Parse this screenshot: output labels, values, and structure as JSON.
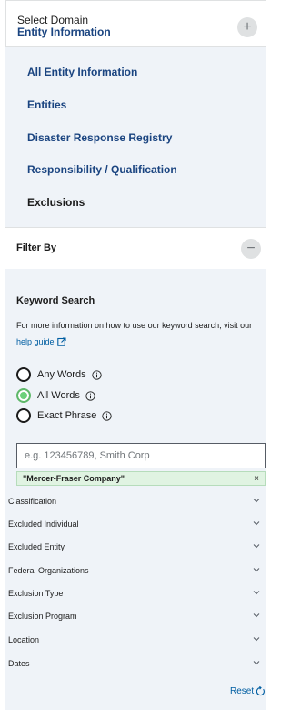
{
  "domain": {
    "select_label": "Select Domain",
    "current": "Entity Information",
    "expand_symbol": "+",
    "items": [
      "All Entity Information",
      "Entities",
      "Disaster Response Registry",
      "Responsibility / Qualification",
      "Exclusions"
    ]
  },
  "filter": {
    "title": "Filter By",
    "collapse_symbol": "−"
  },
  "keyword": {
    "title": "Keyword Search",
    "description": "For more information on how to use our keyword search, visit our",
    "help_link": "help guide",
    "options": [
      "Any Words",
      "All Words",
      "Exact Phrase"
    ],
    "selected": "All Words",
    "placeholder": "e.g. 123456789, Smith Corp",
    "chip": "\"Mercer-Fraser Company\"",
    "chip_close": "×"
  },
  "accordions": [
    "Classification",
    "Excluded Individual",
    "Excluded Entity",
    "Federal Organizations",
    "Exclusion Type",
    "Exclusion Program",
    "Location",
    "Dates"
  ],
  "reset_label": "Reset",
  "colors": {
    "panel_bg": "#eff3f8",
    "link_blue": "#1a4480",
    "accent_green": "#6cd17a",
    "chip_bg": "#e0f3e2"
  }
}
